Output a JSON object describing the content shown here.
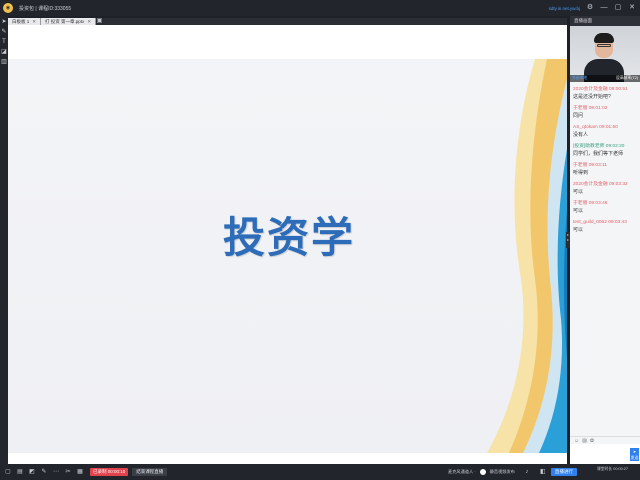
{
  "window": {
    "title": "投资包 | 课程ID:333055",
    "user_link": "sdty.in.net.yw.bj",
    "logo": "app-logo"
  },
  "tabs": [
    {
      "label": "白板板 1"
    },
    {
      "label": "打 投资 第一章.pptx"
    }
  ],
  "slide": {
    "title": "投资学"
  },
  "right_panel": {
    "header": "直播画面",
    "video": {
      "left_label": "关闭本地",
      "right_label": "设高帧率(72)"
    },
    "messages": [
      {
        "sender": "2020会计及金融",
        "time": "09:00:51",
        "text": "这是还没开始吧?",
        "role": "student"
      },
      {
        "sender": "于老丽",
        "time": "09:01:02",
        "text": "同问",
        "role": "student"
      },
      {
        "sender": "AS_qtokam",
        "time": "09:01:50",
        "text": "没有人",
        "role": "student"
      },
      {
        "sender": "[投资]助教老师",
        "time": "09:02:20",
        "text": "同学们，我们等下老师",
        "role": "teacher"
      },
      {
        "sender": "于老丽",
        "time": "09:03:11",
        "text": "听得到",
        "role": "student"
      },
      {
        "sender": "2020会计及金融",
        "time": "09:03:32",
        "text": "可以",
        "role": "student"
      },
      {
        "sender": "于老丽",
        "time": "09:03:46",
        "text": "可以",
        "role": "student"
      },
      {
        "sender": "test_guild_0062",
        "time": "09:03:43",
        "text": "可以",
        "role": "student"
      }
    ],
    "send_label": "发送"
  },
  "bottombar": {
    "record_label": "已录制 00:00:10",
    "end_label": "结束课程直播",
    "mic_label": "麦克风通道人 ·",
    "toggle_label": "静音视频发布",
    "publish_label": "直播进行",
    "class_time_label": "课堂时长",
    "class_time_value": "00:00:27"
  }
}
